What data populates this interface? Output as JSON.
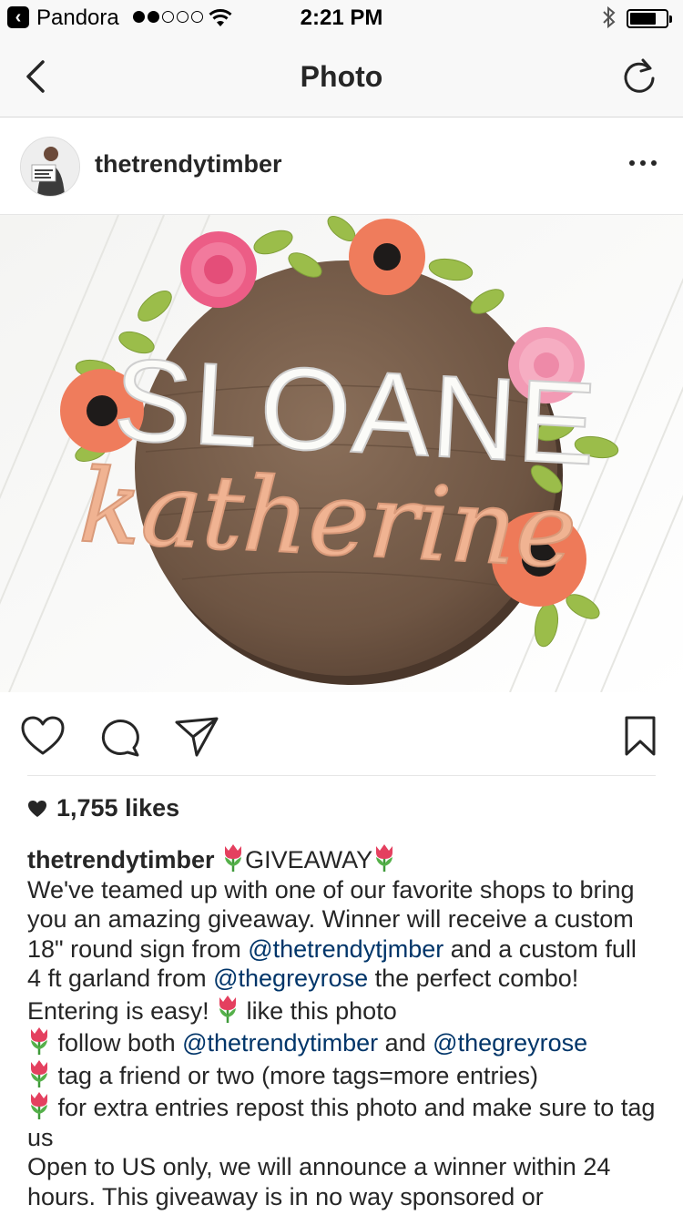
{
  "status_bar": {
    "back_app": "Pandora",
    "time": "2:21 PM"
  },
  "nav": {
    "title": "Photo",
    "back_icon": "chevron-left-icon",
    "refresh_icon": "refresh-icon"
  },
  "post": {
    "username": "thetrendytimber",
    "more_icon": "more-horizontal-icon",
    "photo_text": {
      "line1": "SLOANE",
      "line2": "katherine"
    },
    "likes": "1,755 likes",
    "caption": {
      "username": "thetrendytimber",
      "title": "GIVEAWAY",
      "body_1": "We've teamed up with one of our favorite shops to bring you an amazing giveaway. Winner will receive a custom 18\" round sign from ",
      "mention_1": "@thetrendytjmber",
      "body_2": " and a custom full 4 ft garland from ",
      "mention_2": "@thegreyrose",
      "body_3": " the perfect combo! Entering is easy! ",
      "body_4": " like this photo",
      "follow_text": " follow both ",
      "mention_3": "@thetrendytimber",
      "and_text": " and ",
      "mention_4": "@thegreyrose",
      "tag_text": " tag a friend or two (more tags=more entries)",
      "repost_text": " for extra entries repost this photo and make sure to tag us",
      "closing": "Open to US only, we will announce a winner within 24 hours. This giveaway is in no way sponsored or"
    }
  },
  "colors": {
    "mention": "#003569",
    "text": "#262626",
    "bar": "#f8f8f8"
  }
}
